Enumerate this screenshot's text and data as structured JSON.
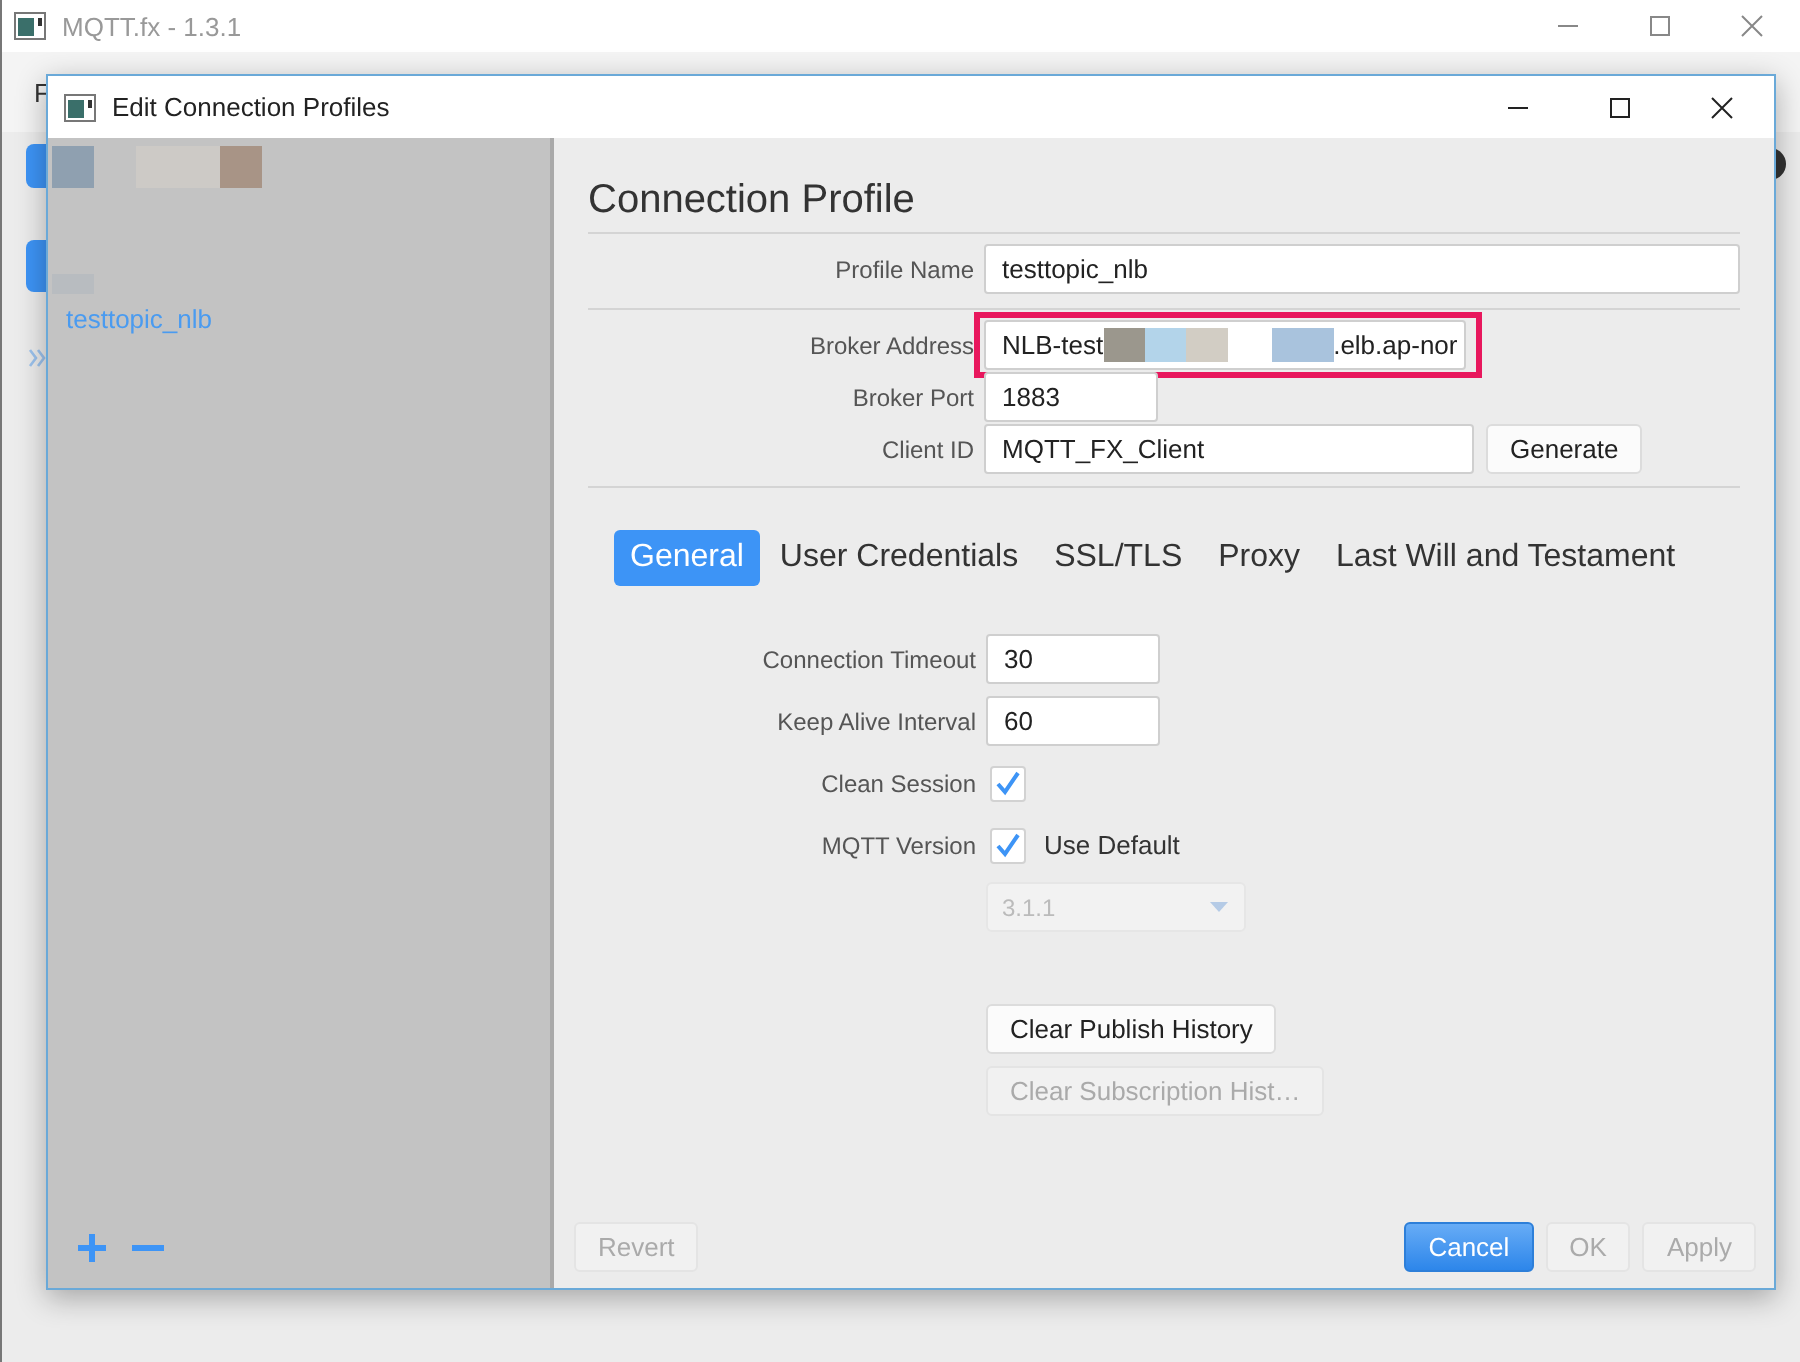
{
  "app_window": {
    "title": "MQTT.fx - 1.3.1",
    "menu": [
      "F"
    ]
  },
  "dialog": {
    "title": "Edit Connection Profiles"
  },
  "profiles": [
    {
      "name": "testtopic_nlb"
    }
  ],
  "heading": "Connection Profile",
  "connection_fields": [
    {
      "kind": "text",
      "label": "Profile Name",
      "value": "testtopic_nlb",
      "highlighted": false
    },
    {
      "kind": "address",
      "label": "Broker Address",
      "value_start": "NLB-test",
      "value_end": ".elb.ap-nor",
      "highlighted": true
    },
    {
      "kind": "port",
      "label": "Broker Port",
      "value": "1883",
      "highlighted": false
    },
    {
      "kind": "client",
      "label": "Client ID",
      "value": "MQTT_FX_Client",
      "button": "Generate",
      "highlighted": false
    }
  ],
  "tabs": [
    {
      "label": "General",
      "selected": true
    },
    {
      "label": "User Credentials",
      "selected": false
    },
    {
      "label": "SSL/TLS",
      "selected": false
    },
    {
      "label": "Proxy",
      "selected": false
    },
    {
      "label": "Last Will and Testament",
      "selected": false
    }
  ],
  "general": [
    {
      "kind": "input",
      "label": "Connection Timeout",
      "value": "30"
    },
    {
      "kind": "input",
      "label": "Keep Alive Interval",
      "value": "60"
    },
    {
      "kind": "check",
      "label": "Clean Session",
      "checked": true
    },
    {
      "kind": "check",
      "label": "MQTT Version",
      "checked": true,
      "text": "Use Default"
    },
    {
      "kind": "select",
      "value": "3.1.1",
      "disabled": true
    }
  ],
  "history_buttons": [
    {
      "label": "Clear Publish History",
      "disabled": false
    },
    {
      "label": "Clear Subscription Hist…",
      "disabled": true
    }
  ],
  "footer_left": [
    {
      "label": "Revert",
      "disabled": true,
      "primary": false
    }
  ],
  "footer_right": [
    {
      "label": "Cancel",
      "disabled": false,
      "primary": true
    },
    {
      "label": "OK",
      "disabled": true,
      "primary": false
    },
    {
      "label": "Apply",
      "disabled": true,
      "primary": false
    }
  ]
}
